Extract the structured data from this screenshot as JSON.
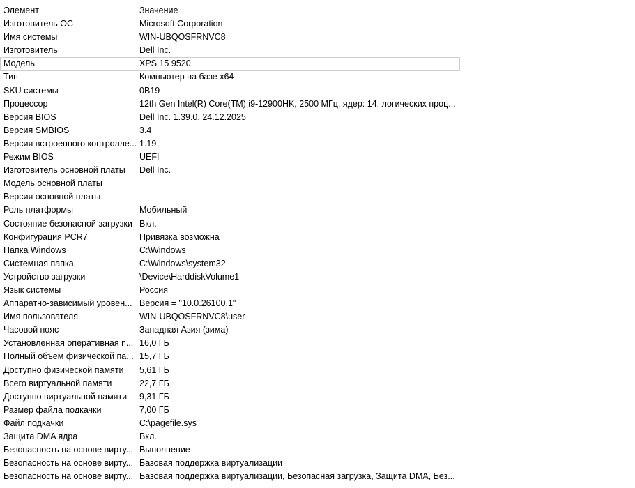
{
  "header": {
    "element": "Элемент",
    "value": "Значение"
  },
  "rows": [
    {
      "item": "Изготовитель ОС",
      "value": "Microsoft Corporation"
    },
    {
      "item": "Имя системы",
      "value": "WIN-UBQOSFRNVC8"
    },
    {
      "item": "Изготовитель",
      "value": "Dell Inc."
    },
    {
      "item": "Модель",
      "value": "XPS 15 9520"
    },
    {
      "item": "Тип",
      "value": "Компьютер на базе x64"
    },
    {
      "item": "SKU системы",
      "value": "0B19"
    },
    {
      "item": "Процессор",
      "value": "12th Gen Intel(R) Core(TM) i9-12900HK, 2500 МГц, ядер: 14, логических проц..."
    },
    {
      "item": "Версия BIOS",
      "value": "Dell Inc. 1.39.0, 24.12.2025"
    },
    {
      "item": "Версия SMBIOS",
      "value": "3.4"
    },
    {
      "item": "Версия встроенного контролле...",
      "value": "1.19"
    },
    {
      "item": "Режим BIOS",
      "value": "UEFI"
    },
    {
      "item": "Изготовитель основной платы",
      "value": "Dell Inc."
    },
    {
      "item": "Модель основной платы",
      "value": ""
    },
    {
      "item": "Версия основной платы",
      "value": ""
    },
    {
      "item": "Роль платформы",
      "value": "Мобильный"
    },
    {
      "item": "Состояние безопасной загрузки",
      "value": "Вкл."
    },
    {
      "item": "Конфигурация PCR7",
      "value": "Привязка возможна"
    },
    {
      "item": "Папка Windows",
      "value": "C:\\Windows"
    },
    {
      "item": "Системная папка",
      "value": "C:\\Windows\\system32"
    },
    {
      "item": "Устройство загрузки",
      "value": "\\Device\\HarddiskVolume1"
    },
    {
      "item": "Язык системы",
      "value": "Россия"
    },
    {
      "item": "Аппаратно-зависимый уровен...",
      "value": "Версия = \"10.0.26100.1\""
    },
    {
      "item": "Имя пользователя",
      "value": "WIN-UBQOSFRNVC8\\user"
    },
    {
      "item": "Часовой пояс",
      "value": "Западная Азия (зима)"
    },
    {
      "item": "Установленная оперативная п...",
      "value": "16,0 ГБ"
    },
    {
      "item": "Полный объем физической па...",
      "value": "15,7 ГБ"
    },
    {
      "item": "Доступно физической памяти",
      "value": "5,61 ГБ"
    },
    {
      "item": "Всего виртуальной памяти",
      "value": "22,7 ГБ"
    },
    {
      "item": "Доступно виртуальной памяти",
      "value": "9,31 ГБ"
    },
    {
      "item": "Размер файла подкачки",
      "value": "7,00 ГБ"
    },
    {
      "item": "Файл подкачки",
      "value": "C:\\pagefile.sys"
    },
    {
      "item": "Защита DMA ядра",
      "value": "Вкл."
    },
    {
      "item": "Безопасность на основе вирту...",
      "value": "Выполнение"
    },
    {
      "item": "Безопасность на основе вирту...",
      "value": "Базовая поддержка виртуализации"
    },
    {
      "item": "Безопасность на основе вирту...",
      "value": "Базовая поддержка виртуализации, Безопасная загрузка, Защита DMA, Без..."
    }
  ]
}
